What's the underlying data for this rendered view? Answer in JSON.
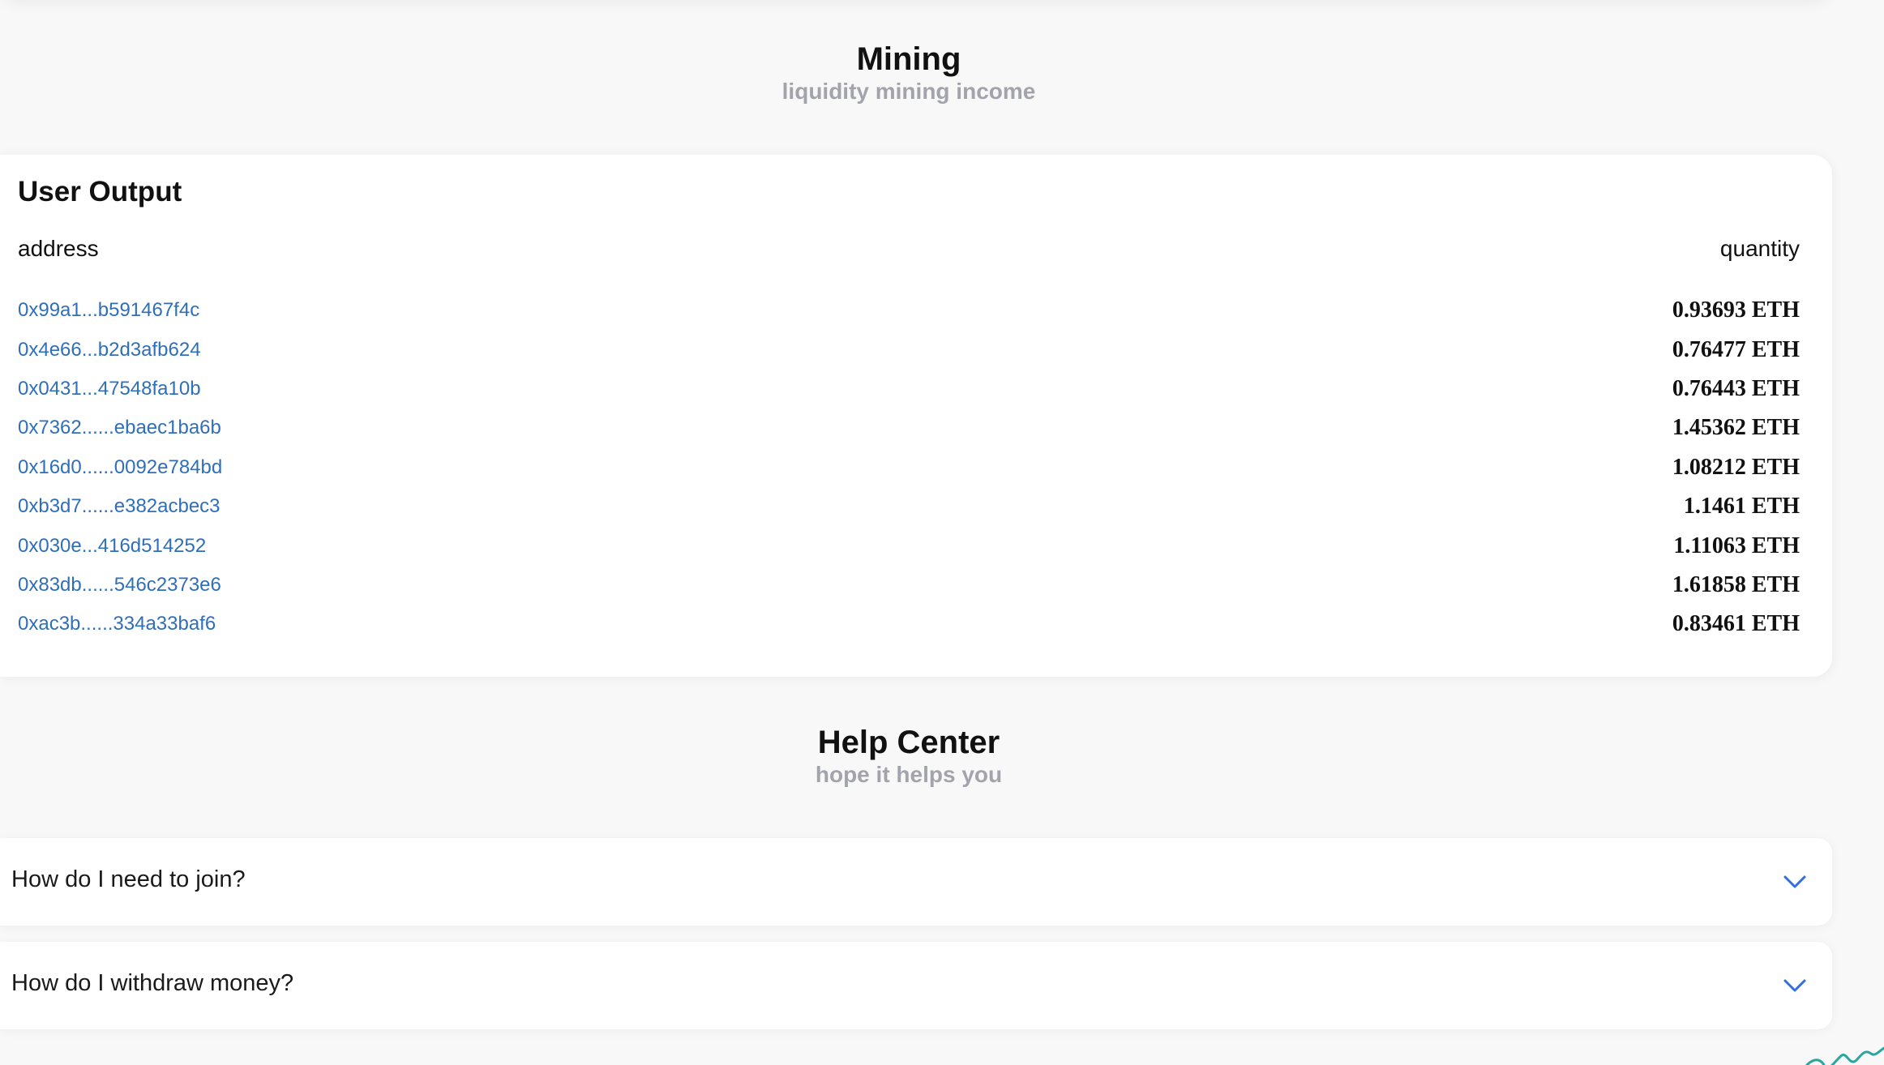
{
  "mining": {
    "title": "Mining",
    "subtitle": "liquidity mining income"
  },
  "user_output": {
    "title": "User Output",
    "columns": {
      "address": "address",
      "quantity": "quantity"
    },
    "rows": [
      {
        "address": "0x99a1...b591467f4c",
        "quantity": "0.93693 ETH"
      },
      {
        "address": "0x4e66...b2d3afb624",
        "quantity": "0.76477 ETH"
      },
      {
        "address": "0x0431...47548fa10b",
        "quantity": "0.76443 ETH"
      },
      {
        "address": "0x7362......ebaec1ba6b",
        "quantity": "1.45362 ETH"
      },
      {
        "address": "0x16d0......0092e784bd",
        "quantity": "1.08212 ETH"
      },
      {
        "address": "0xb3d7......e382acbec3",
        "quantity": "1.1461 ETH"
      },
      {
        "address": "0x030e...416d514252",
        "quantity": "1.11063 ETH"
      },
      {
        "address": "0x83db......546c2373e6",
        "quantity": "1.61858 ETH"
      },
      {
        "address": "0xac3b......334a33baf6",
        "quantity": "0.83461 ETH"
      }
    ]
  },
  "help_center": {
    "title": "Help Center",
    "subtitle": "hope it helps you",
    "questions": [
      {
        "label": "How do I need to join?",
        "icon": "chevron-down-icon"
      },
      {
        "label": "How do I withdraw money?",
        "icon": "chevron-down-icon"
      }
    ]
  },
  "colors": {
    "background": "#f8f8f9",
    "link": "#2f6fba",
    "subtitle": "#a3a3ab",
    "chevron": "#2f6fde"
  }
}
